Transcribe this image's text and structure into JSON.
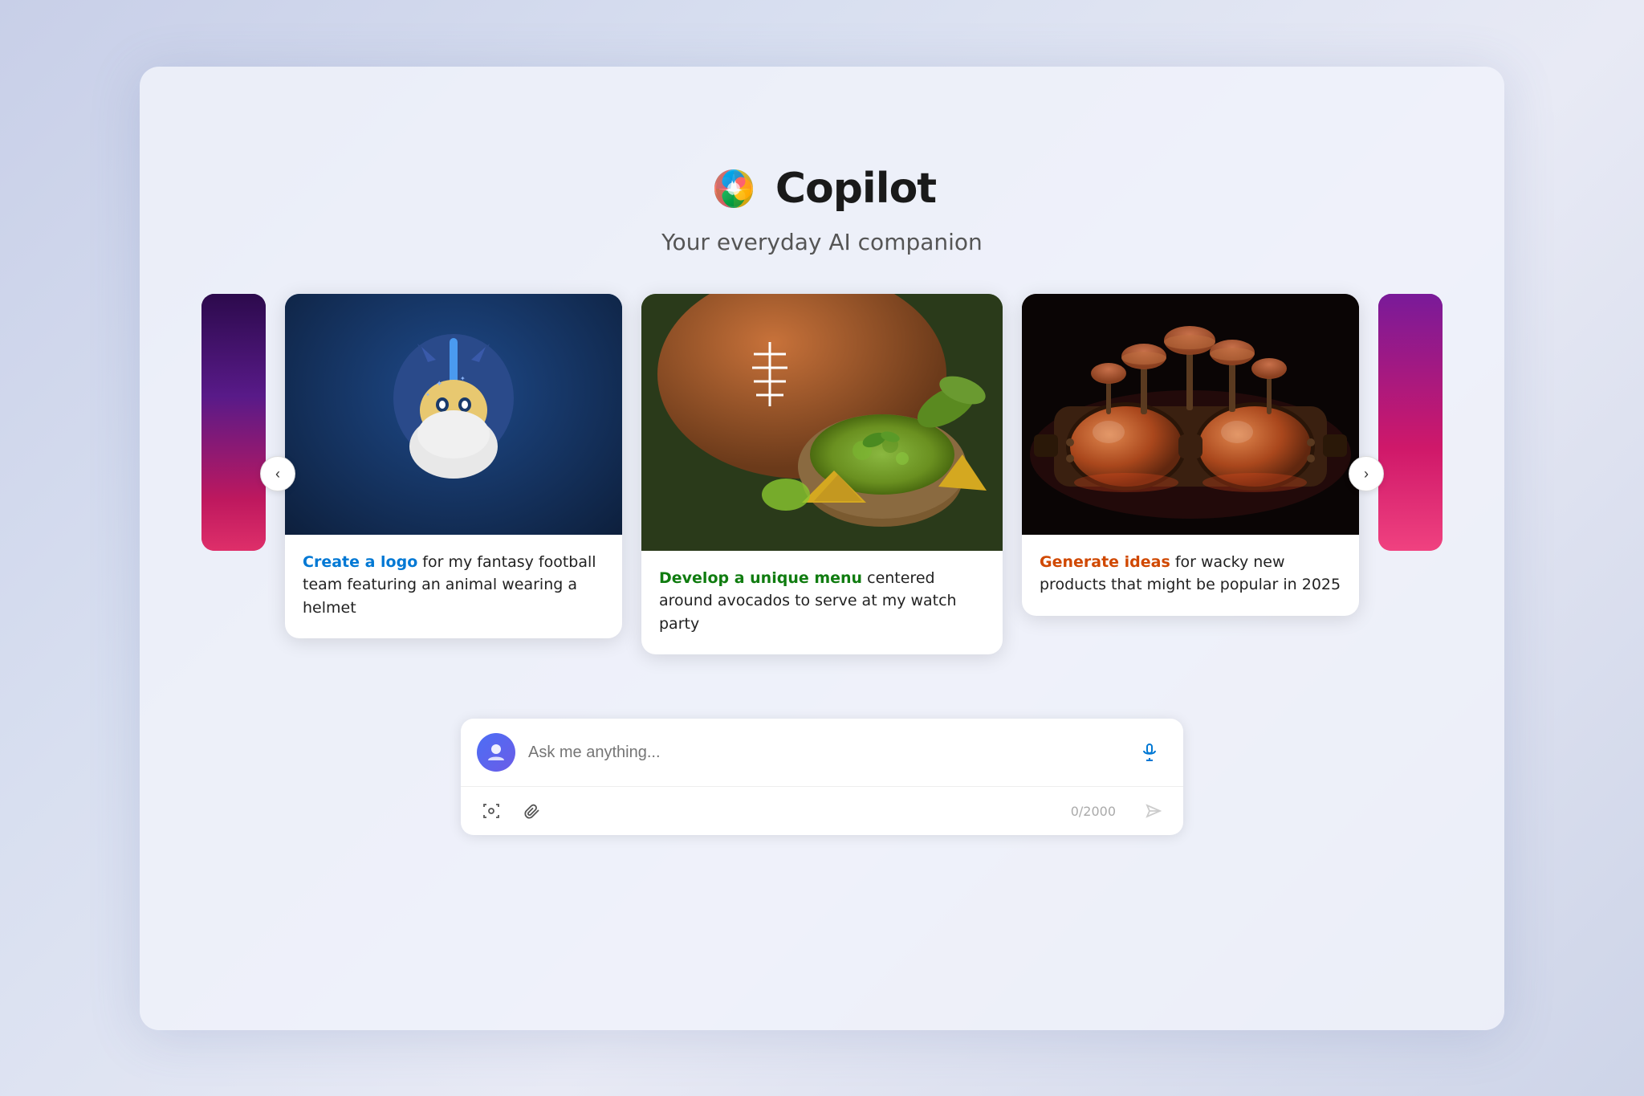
{
  "app": {
    "title": "Copilot",
    "tagline": "Your everyday AI companion"
  },
  "carousel": {
    "nav_left": "‹",
    "nav_right": "›",
    "cards": [
      {
        "id": "football",
        "highlight": "Create a logo",
        "highlight_color": "highlight-blue",
        "text": " for my fantasy football team featuring an animal wearing a helmet",
        "image_alt": "Fantasy football lion mascot with helmet"
      },
      {
        "id": "avocado",
        "highlight": "Develop a unique menu",
        "highlight_color": "highlight-green",
        "text": " centered around avocados to serve at my watch party",
        "image_alt": "Avocado guacamole with football"
      },
      {
        "id": "products",
        "highlight": "Generate ideas",
        "highlight_color": "highlight-orange",
        "text": " for wacky new products that might be popular in 2025",
        "image_alt": "Futuristic goggles with mushrooms"
      }
    ]
  },
  "chat": {
    "placeholder": "Ask me anything...",
    "char_count": "0/2000",
    "avatar_label": "Copilot avatar",
    "mic_label": "Microphone",
    "image_icon_label": "Image",
    "attach_label": "Attach",
    "send_label": "Send"
  }
}
